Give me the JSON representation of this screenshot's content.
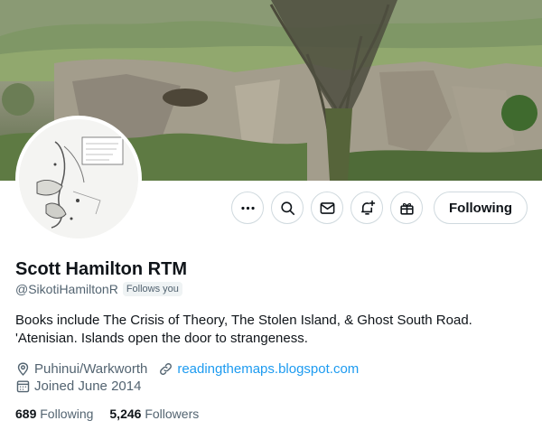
{
  "profile": {
    "display_name": "Scott Hamilton RTM",
    "handle": "@SikotiHamiltonR",
    "follows_you": "Follows you",
    "bio_line1": "Books include The Crisis of Theory, The Stolen Island, & Ghost South Road.",
    "bio_line2": "'Atenisian. Islands open the door to strangeness.",
    "location": "Puhinui/Warkworth",
    "website": "readingthemaps.blogspot.com",
    "joined": "Joined June 2014"
  },
  "stats": {
    "following_count": "689",
    "following_label": "Following",
    "followers_count": "5,246",
    "followers_label": "Followers"
  },
  "actions": {
    "more_icon": "more-icon",
    "search_icon": "search-icon",
    "message_icon": "mail-icon",
    "notify_icon": "bell-plus-icon",
    "subscribe_icon": "gift-icon",
    "follow_label": "Following"
  },
  "colors": {
    "link": "#1d9bf0",
    "secondary_text": "#536471",
    "primary_text": "#0f1419",
    "border": "#cfd9de"
  }
}
